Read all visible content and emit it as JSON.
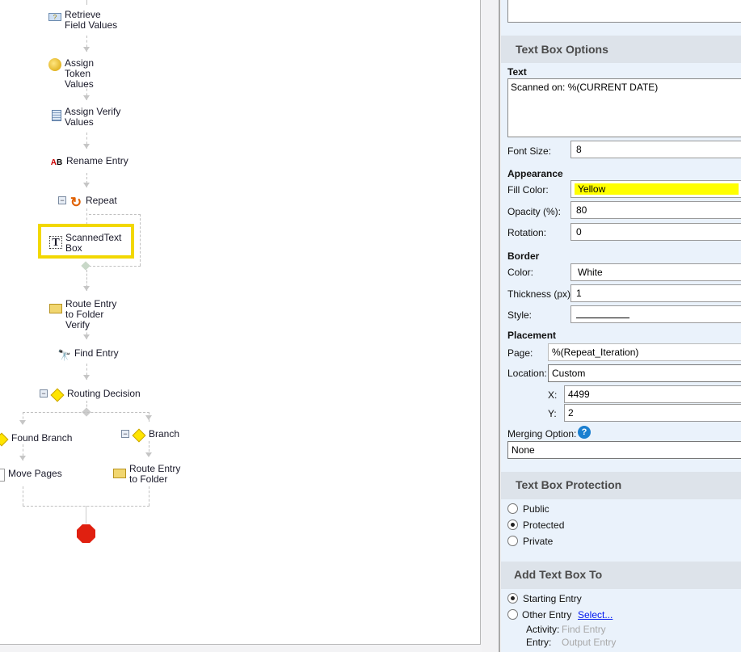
{
  "workflow": {
    "nodes": {
      "retrieve_field_values": "Retrieve Field Values",
      "assign_token_values": "Assign Token Values",
      "assign_verify_values": "Assign Verify Values",
      "rename_entry": "Rename Entry",
      "repeat": "Repeat",
      "scanned_text_box": "ScannedText Box",
      "route_entry_folder_verify": "Route Entry to Folder Verify",
      "find_entry": "Find Entry",
      "routing_decision": "Routing Decision",
      "found_branch": "Found Branch",
      "branch": "Branch",
      "move_pages": "Move Pages",
      "route_entry_folder": "Route Entry to Folder"
    },
    "selected_color": "#f2d800"
  },
  "panel": {
    "text_box_options": {
      "title": "Text Box Options",
      "text_label": "Text",
      "text_value": "Scanned on: %(CURRENT DATE)",
      "font_size_label": "Font Size:",
      "font_size_value": "8",
      "appearance_label": "Appearance",
      "fill_color_label": "Fill Color:",
      "fill_color_value": "Yellow",
      "fill_color_hex": "#ffff00",
      "opacity_label": "Opacity (%):",
      "opacity_value": "80",
      "rotation_label": "Rotation:",
      "rotation_value": "0",
      "border_label": "Border",
      "border_color_label": "Color:",
      "border_color_value": "White",
      "thickness_label": "Thickness (px):",
      "thickness_value": "1",
      "style_label": "Style:",
      "placement_label": "Placement",
      "page_label": "Page:",
      "page_value": "%(Repeat_Iteration)",
      "location_label": "Location:",
      "location_value": "Custom",
      "x_label": "X:",
      "x_value": "4499",
      "y_label": "Y:",
      "y_value": "2",
      "merging_label": "Merging Option:",
      "merging_value": "None"
    },
    "protection": {
      "title": "Text Box Protection",
      "options": [
        "Public",
        "Protected",
        "Private"
      ],
      "selected": "Protected"
    },
    "add_to": {
      "title": "Add Text Box To",
      "starting_entry": "Starting Entry",
      "other_entry": "Other Entry",
      "select_link": "Select...",
      "activity_label": "Activity:",
      "activity_value": "Find Entry",
      "entry_label": "Entry:",
      "entry_value": "Output Entry"
    }
  }
}
